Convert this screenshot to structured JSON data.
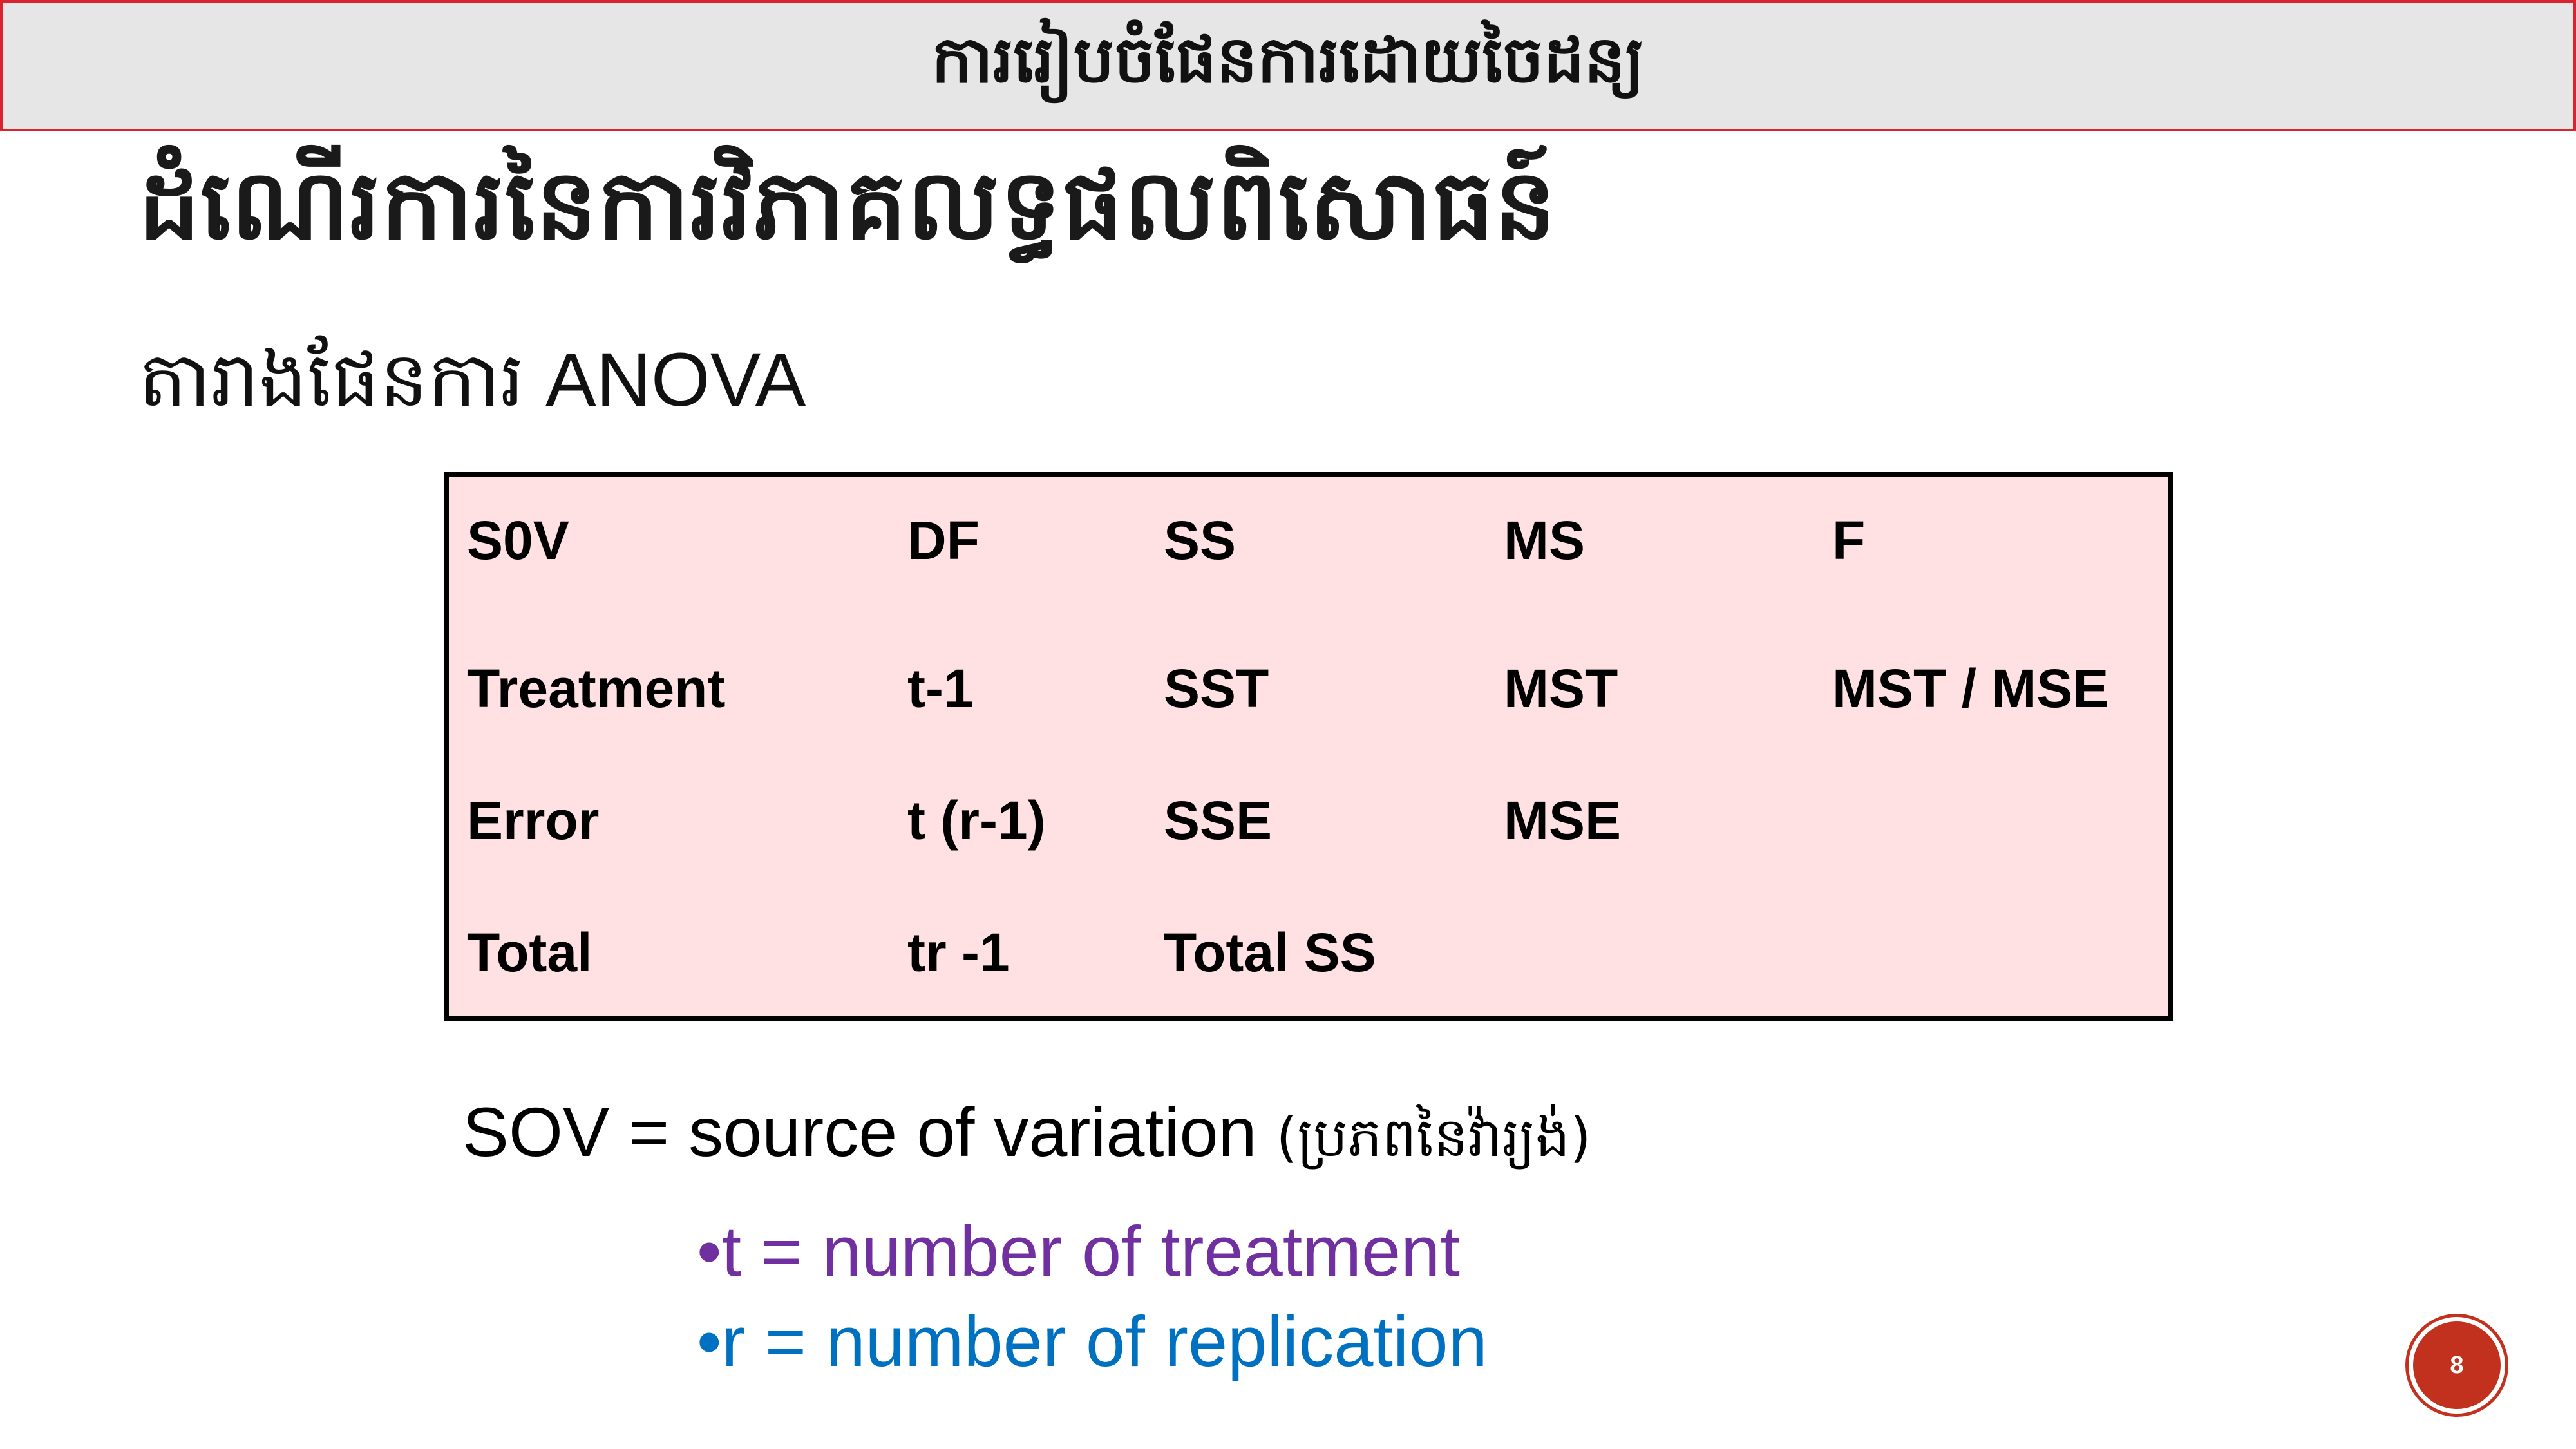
{
  "header": {
    "banner_text": "ការរៀបចំផែនការដោយចៃដន្យ"
  },
  "slide": {
    "title": "ដំណើរការនៃការវិភាគលទ្ធផលពិសោធន៍",
    "subtitle": "តារាងផែនការ ANOVA"
  },
  "table": {
    "headers": [
      "S0V",
      "DF",
      "SS",
      "MS",
      "F"
    ],
    "rows": [
      [
        "Treatment",
        "t-1",
        "SST",
        "MST",
        "MST / MSE"
      ],
      [
        "Error",
        "t (r-1)",
        "SSE",
        "MSE",
        ""
      ],
      [
        "Total",
        "tr -1",
        "Total SS",
        "",
        ""
      ]
    ],
    "background_color": "#ffe1e3"
  },
  "definition": {
    "text": "SOV = source of variation",
    "note": "(ប្រភពនៃវ៉ារ្យង់)"
  },
  "bullets": [
    {
      "text": "•t = number of treatment",
      "color": "#7030a0"
    },
    {
      "text": "•r = number of replication",
      "color": "#0070c0"
    }
  ],
  "page_number": "8",
  "colors": {
    "banner_border": "#d9232e",
    "banner_bg": "#e7e6e6",
    "badge": "#c2311e"
  }
}
